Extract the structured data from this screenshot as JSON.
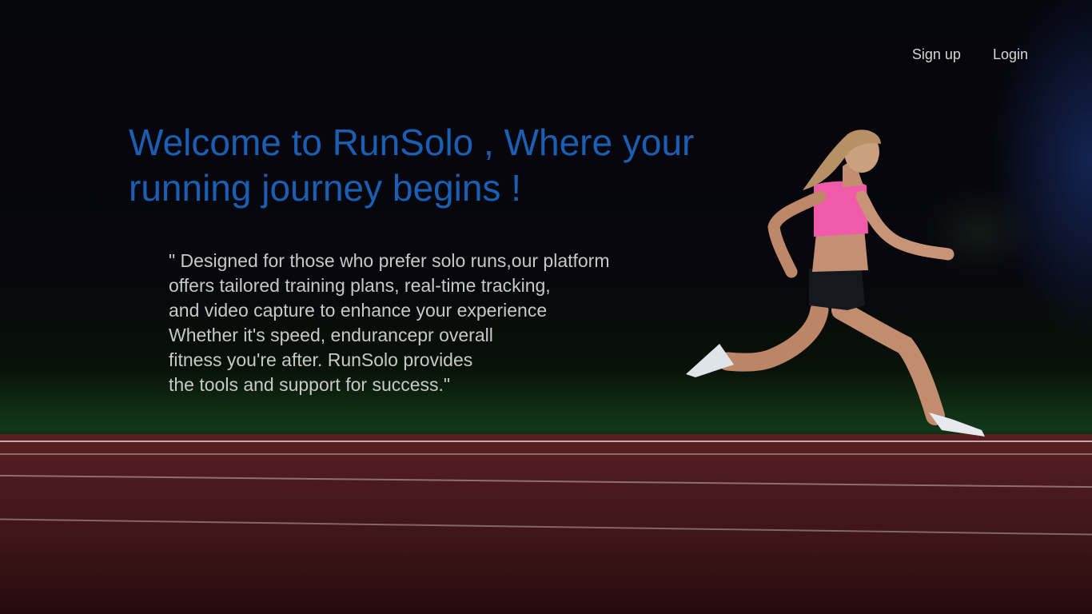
{
  "nav": {
    "signup_label": "Sign up",
    "login_label": "Login"
  },
  "hero": {
    "headline": "Welcome to RunSolo , Where your running journey begins !",
    "quote_lines": [
      "\" Designed for those who prefer solo runs,our platform",
      "offers tailored training plans, real-time tracking,",
      "and video capture to enhance your experience",
      "Whether it's speed, endurancepr overall",
      "fitness you're after. RunSolo provides",
      "the tools and support for success.\""
    ]
  },
  "background": {
    "image": "runner-on-track-photo",
    "colors": {
      "headline": "#1a5fb4",
      "body_text": "#c8c8c8",
      "nav_text": "#d6d6d6",
      "track": "#4a1a1d",
      "grass": "#13381a",
      "top_wear": "#f05aa8",
      "shorts": "#15181f"
    }
  }
}
